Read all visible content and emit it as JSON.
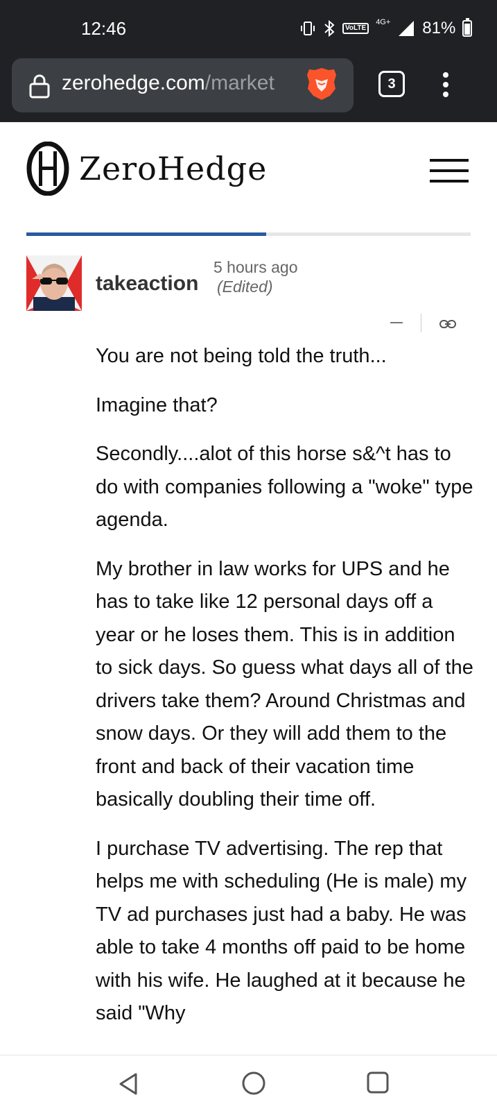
{
  "status_bar": {
    "time": "12:46",
    "network_label": "4G+",
    "lte_label": "VoLTE",
    "battery": "81%",
    "battery_level": 0.81,
    "icons": [
      "vibrate-icon",
      "bluetooth-icon",
      "volte-icon",
      "signal-icon",
      "battery-icon"
    ]
  },
  "browser": {
    "url_domain": "zerohedge.com",
    "url_path": "/market",
    "tab_count": "3",
    "icons": [
      "lock-icon",
      "brave-icon",
      "tabs-icon",
      "more-vert-icon"
    ]
  },
  "site": {
    "name": "ZeroHedge",
    "reading_progress": 0.54,
    "accent_color": "#275b9f"
  },
  "comment": {
    "author": "takeaction",
    "time": "5 hours ago",
    "edited": "(Edited)",
    "collapse_label": "–",
    "paragraphs": [
      "You are not being told the truth...",
      "Imagine that?",
      "Secondly....alot of this horse s&^t has to do with companies following a \"woke\" type agenda.",
      "My brother in law works for UPS and he has to take like 12 personal days off a year or he loses them. This is in addition to sick days.   So guess what days all of the drivers take them? Around Christmas and snow days.  Or they will add them to the front and back of their vacation time basically doubling their time off.",
      "I purchase TV advertising.  The rep that helps me with scheduling (He is male)  my TV ad purchases just had a baby.  He was able to take 4 months off paid to be home with his wife.  He laughed at it because he said \"Why"
    ]
  },
  "nav_bar": {
    "icons": [
      "back-icon",
      "home-icon",
      "recents-icon"
    ]
  }
}
